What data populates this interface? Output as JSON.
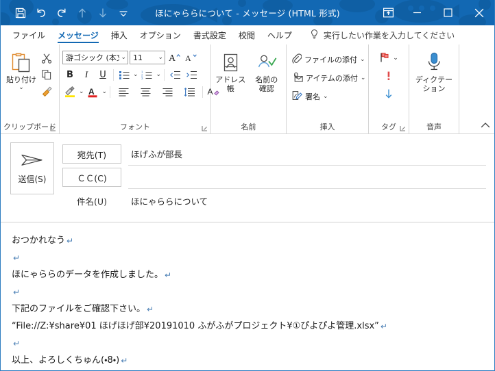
{
  "window": {
    "title": "ほにゃららについて  -  メッセージ (HTML 形式)",
    "accent_color": "#1268b3",
    "border_color": "#2a7bc0"
  },
  "quick_access": [
    {
      "name": "save-button",
      "icon": "save-icon",
      "enabled": true
    },
    {
      "name": "undo-button",
      "icon": "undo-icon",
      "enabled": true
    },
    {
      "name": "redo-button",
      "icon": "redo-icon",
      "enabled": true
    },
    {
      "name": "previous-item-button",
      "icon": "arrow-up-icon",
      "enabled": false
    },
    {
      "name": "next-item-button",
      "icon": "arrow-down-icon",
      "enabled": false
    },
    {
      "name": "customize-quick-access-button",
      "icon": "chevron-down-icon",
      "enabled": true
    }
  ],
  "caption_buttons": {
    "ribbon_display_options": "ribbon-display-options-icon",
    "minimize": "minimize-icon",
    "maximize": "maximize-icon",
    "close": "close-icon"
  },
  "tabs": [
    {
      "label": "ファイル",
      "active": false
    },
    {
      "label": "メッセージ",
      "active": true
    },
    {
      "label": "挿入",
      "active": false
    },
    {
      "label": "オプション",
      "active": false
    },
    {
      "label": "書式設定",
      "active": false
    },
    {
      "label": "校閲",
      "active": false
    },
    {
      "label": "ヘルプ",
      "active": false
    }
  ],
  "tell_me": {
    "icon": "lightbulb-icon",
    "placeholder": "実行したい作業を入力してください"
  },
  "ribbon": {
    "clipboard": {
      "label": "クリップボード",
      "paste_label": "貼り付け",
      "cut_label": "切り取り",
      "copy_label": "コピー",
      "format_painter_label": "書式のコピー/貼り付け",
      "has_launcher": true
    },
    "font": {
      "label": "フォント",
      "font_name": "游ゴシック (本文の",
      "font_size": "11",
      "grow_font_label": "フォントサイズの拡大",
      "shrink_font_label": "フォントサイズの縮小",
      "bold_label": "B",
      "italic_label": "I",
      "underline_label": "U",
      "bullets_label": "箇条書き",
      "numbering_label": "段落番号",
      "decrease_indent_label": "インデントを減らす",
      "increase_indent_label": "インデントを増やす",
      "highlight_label": "蛍光ペンの色",
      "highlight_color": "#ffe400",
      "font_color_label": "フォントの色",
      "font_color": "#e02020",
      "align_left_label": "左揃え",
      "align_center_label": "中央揃え",
      "align_right_label": "右揃え",
      "line_spacing_label": "行と段落の間隔",
      "clear_format_label": "すべての書式をクリア",
      "has_launcher": true
    },
    "names": {
      "label": "名前",
      "address_book_label": "アドレス帳",
      "check_names_label": "名前の\n確認",
      "check_names_line1": "名前の",
      "check_names_line2": "確認"
    },
    "include": {
      "label": "挿入",
      "items": [
        {
          "label": "ファイルの添付",
          "icon": "paperclip-icon",
          "caret": true
        },
        {
          "label": "アイテムの添付",
          "icon": "attach-item-icon",
          "caret": true
        },
        {
          "label": "署名",
          "icon": "signature-icon",
          "caret": true
        }
      ]
    },
    "tags": {
      "label": "タグ",
      "follow_up_label": "フォローアップ",
      "high_importance_label": "重要度 - 高",
      "low_importance_label": "重要度 - 低",
      "has_launcher": true
    },
    "voice": {
      "label": "音声",
      "dictate_line1": "ディクテー",
      "dictate_line2": "ション",
      "dictate_label": "ディクテーション"
    },
    "collapse_label": "リボンを折りたたむ"
  },
  "compose": {
    "send_button": "送信(S)",
    "to_button": "宛先(T)",
    "to_value": "ほげふが部長",
    "cc_button": "ＣＣ(C)",
    "cc_value": "",
    "subject_label": "件名(U)",
    "subject_value": "ほにゃららについて"
  },
  "body_lines": [
    {
      "text": "おつかれなう",
      "mark": "↵"
    },
    {
      "text": "",
      "mark": "↵"
    },
    {
      "text": "ほにゃららのデータを作成しました。",
      "mark": "↵"
    },
    {
      "text": "",
      "mark": "↵"
    },
    {
      "text": "下記のファイルをご確認下さい。",
      "mark": "↵"
    },
    {
      "text": "“File://Z:¥share¥01 ほげほげ部¥20191010 ふがふがプロジェクト¥①ぴよぴよ管理.xlsx”",
      "mark": "↵"
    },
    {
      "text": "",
      "mark": "↵"
    },
    {
      "text": "以上、よろしくちゅん(・8・)",
      "mark": "↵"
    }
  ]
}
